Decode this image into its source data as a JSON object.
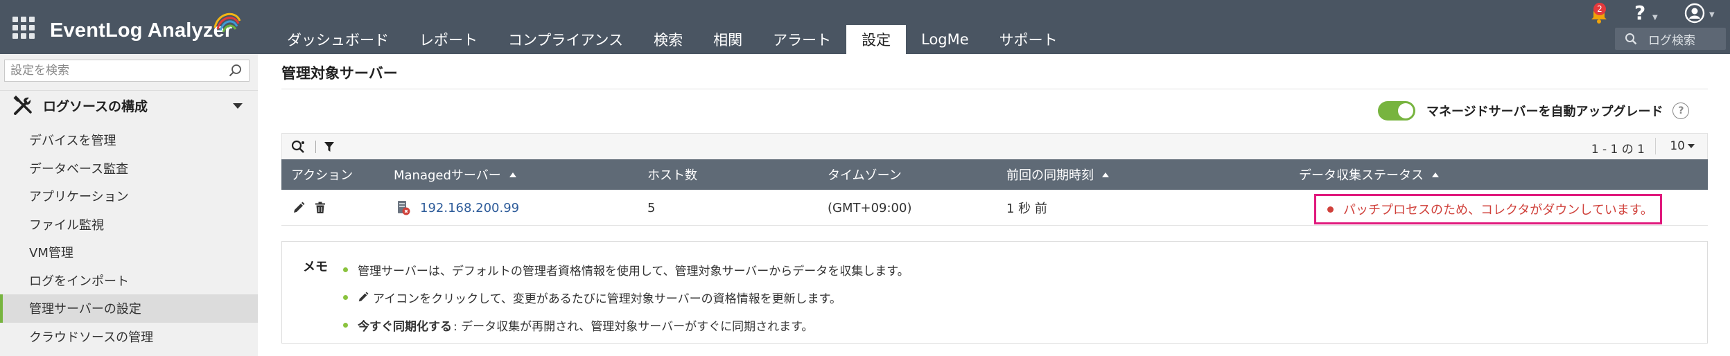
{
  "header": {
    "brand": "EventLog Analyzer",
    "tabs": [
      {
        "label": "ダッシュボード"
      },
      {
        "label": "レポート"
      },
      {
        "label": "コンプライアンス"
      },
      {
        "label": "検索"
      },
      {
        "label": "相関"
      },
      {
        "label": "アラート"
      },
      {
        "label": "設定",
        "active": true
      },
      {
        "label": "LogMe"
      },
      {
        "label": "サポート"
      }
    ],
    "notification_count": "2",
    "help_label": "?",
    "log_search_label": "ログ検索"
  },
  "sidebar": {
    "search_placeholder": "設定を検索",
    "section_title": "ログソースの構成",
    "items": [
      {
        "label": "デバイスを管理"
      },
      {
        "label": "データベース監査"
      },
      {
        "label": "アプリケーション"
      },
      {
        "label": "ファイル監視"
      },
      {
        "label": "VM管理"
      },
      {
        "label": "ログをインポート"
      },
      {
        "label": "管理サーバーの設定",
        "selected": true
      },
      {
        "label": "クラウドソースの管理"
      }
    ]
  },
  "main": {
    "title": "管理対象サーバー",
    "auto_upgrade_label": "マネージドサーバーを自動アップグレード",
    "auto_upgrade_enabled": true,
    "pager": "1 - 1 の 1",
    "per_page": "10",
    "columns": [
      "アクション",
      "Managedサーバー",
      "ホスト数",
      "タイムゾーン",
      "前回の同期時刻",
      "データ収集ステータス"
    ],
    "rows": [
      {
        "server": "192.168.200.99",
        "hosts": "5",
        "timezone": "(GMT+09:00)",
        "last_sync": "1 秒 前",
        "status": "パッチプロセスのため、コレクタがダウンしています。"
      }
    ],
    "memo": {
      "title": "メモ",
      "line1": "管理サーバーは、デフォルトの管理者資格情報を使用して、管理対象サーバーからデータを収集します。",
      "line2": "アイコンをクリックして、変更があるたびに管理対象サーバーの資格情報を更新します。",
      "line3_bold": "今すぐ同期化する",
      "line3_rest": ": データ収集が再開され、管理対象サーバーがすぐに同期されます。"
    }
  },
  "colors": {
    "topbar": "#4a5562",
    "table_header": "#5f6a76",
    "accent_green": "#77b43f",
    "status_red": "#d0413b",
    "highlight_magenta": "#e0197d",
    "link_blue": "#2e5c9a"
  }
}
